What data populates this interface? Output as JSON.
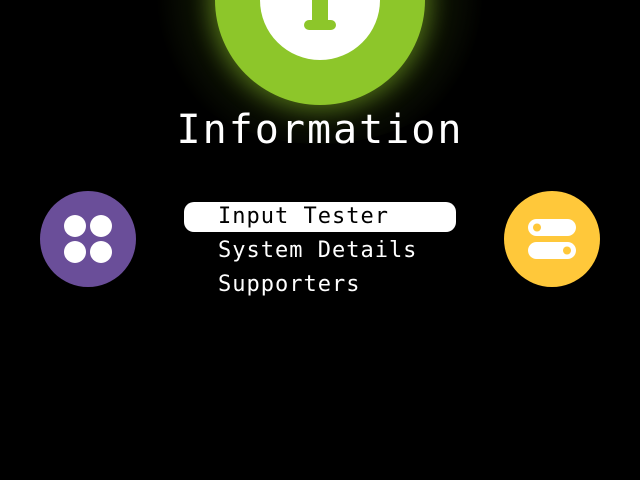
{
  "header": {
    "title": "Information",
    "icon": "info-icon",
    "accent_color": "#8dc62a"
  },
  "menu": {
    "items": [
      {
        "label": "Input Tester",
        "selected": true
      },
      {
        "label": "System Details",
        "selected": false
      },
      {
        "label": "Supporters",
        "selected": false
      }
    ]
  },
  "side_icons": {
    "left": {
      "icon": "apps-grid-icon",
      "color": "#6a4e99"
    },
    "right": {
      "icon": "toggles-icon",
      "color": "#ffc83a"
    }
  }
}
